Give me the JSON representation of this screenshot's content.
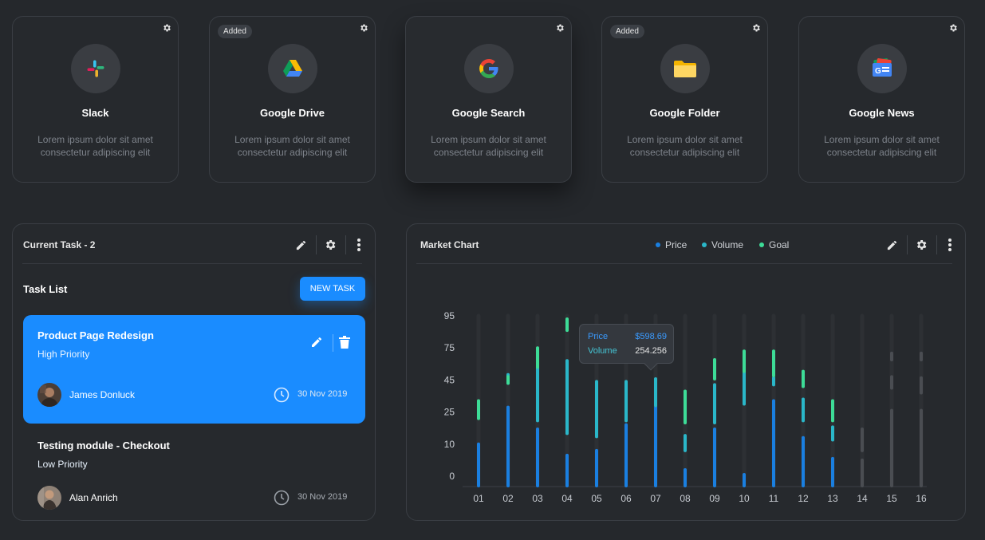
{
  "integrations": [
    {
      "name": "Slack",
      "desc": "Lorem ipsum dolor sit amet consectetur adipiscing elit",
      "badge": "",
      "icon": "slack-icon"
    },
    {
      "name": "Google Drive",
      "desc": "Lorem ipsum dolor sit amet consectetur adipiscing elit",
      "badge": "Added",
      "icon": "google-drive-icon"
    },
    {
      "name": "Google Search",
      "desc": "Lorem ipsum dolor sit amet consectetur adipiscing elit",
      "badge": "",
      "icon": "google-search-icon"
    },
    {
      "name": "Google Folder",
      "desc": "Lorem ipsum dolor sit amet consectetur adipiscing elit",
      "badge": "Added",
      "icon": "google-folder-icon"
    },
    {
      "name": "Google News",
      "desc": "Lorem ipsum dolor sit amet consectetur adipiscing elit",
      "badge": "",
      "icon": "google-news-icon"
    }
  ],
  "task_panel": {
    "title": "Current Task - 2",
    "list_label": "Task List",
    "new_task_button": "NEW TASK",
    "tasks": [
      {
        "title": "Product Page Redesign",
        "priority": "High Priority",
        "assignee": "James Donluck",
        "date": "30 Nov 2019",
        "active": true
      },
      {
        "title": "Testing module - Checkout",
        "priority": "Low Priority",
        "assignee": "Alan Anrich",
        "date": "30 Nov 2019",
        "active": false
      }
    ]
  },
  "market_panel": {
    "title": "Market Chart",
    "legend": [
      {
        "label": "Price",
        "color": "#1a7fe0"
      },
      {
        "label": "Volume",
        "color": "#2ab7c9"
      },
      {
        "label": "Goal",
        "color": "#3ddc97"
      }
    ],
    "tooltip": {
      "price_label": "Price",
      "price_value": "$598.69",
      "volume_label": "Volume",
      "volume_value": "254.256"
    }
  },
  "colors": {
    "accent": "#1a8cff",
    "price": "#1a7fe0",
    "volume": "#2ab7c9",
    "goal": "#3ddc97",
    "inactive": "#4a4d52"
  },
  "chart_data": {
    "type": "bar",
    "subtype": "stacked-range",
    "title": "Market Chart",
    "yticks": [
      "0",
      "10",
      "25",
      "45",
      "75",
      "95"
    ],
    "categories": [
      "01",
      "02",
      "03",
      "04",
      "05",
      "06",
      "07",
      "08",
      "09",
      "10",
      "11",
      "12",
      "13",
      "14",
      "15",
      "16"
    ],
    "series": [
      {
        "name": "Price",
        "segments": [
          [
            0,
            10
          ],
          [
            0,
            28
          ],
          [
            0,
            17
          ],
          [
            0,
            6.5
          ],
          [
            0,
            8
          ],
          [
            0,
            19
          ],
          [
            0,
            28
          ],
          [
            0,
            2
          ],
          [
            0,
            17
          ],
          [
            0,
            0.5
          ],
          [
            0,
            32
          ],
          [
            0,
            13
          ],
          [
            0,
            5.5
          ],
          [
            0,
            5
          ],
          [
            0,
            26
          ],
          [
            0,
            26
          ]
        ]
      },
      {
        "name": "Volume",
        "segments": [
          [
            null,
            null
          ],
          [
            43,
            50
          ],
          [
            21,
            63
          ],
          [
            15,
            63
          ],
          [
            13.5,
            44
          ],
          [
            21,
            44
          ],
          [
            29,
            46
          ],
          [
            8,
            14
          ],
          [
            20,
            42
          ],
          [
            30,
            62
          ],
          [
            42,
            47
          ],
          [
            21,
            33
          ],
          [
            12,
            18
          ],
          [
            8,
            17
          ],
          [
            40,
            48
          ],
          [
            37,
            47
          ]
        ]
      },
      {
        "name": "Goal",
        "segments": [
          [
            22,
            32
          ],
          [
            43,
            48
          ],
          [
            57,
            75
          ],
          [
            86,
            93
          ],
          [
            null,
            null
          ],
          [
            null,
            null
          ],
          [
            null,
            null
          ],
          [
            20,
            38
          ],
          [
            46,
            64
          ],
          [
            53,
            72
          ],
          [
            49,
            72
          ],
          [
            41,
            53
          ],
          [
            21,
            32
          ],
          [
            null,
            null
          ],
          [
            64,
            70
          ],
          [
            64,
            70
          ]
        ]
      }
    ],
    "inactive_categories": [
      "14",
      "15",
      "16"
    ],
    "ylim": [
      0,
      95
    ],
    "grid": false,
    "legend_position": "top"
  }
}
